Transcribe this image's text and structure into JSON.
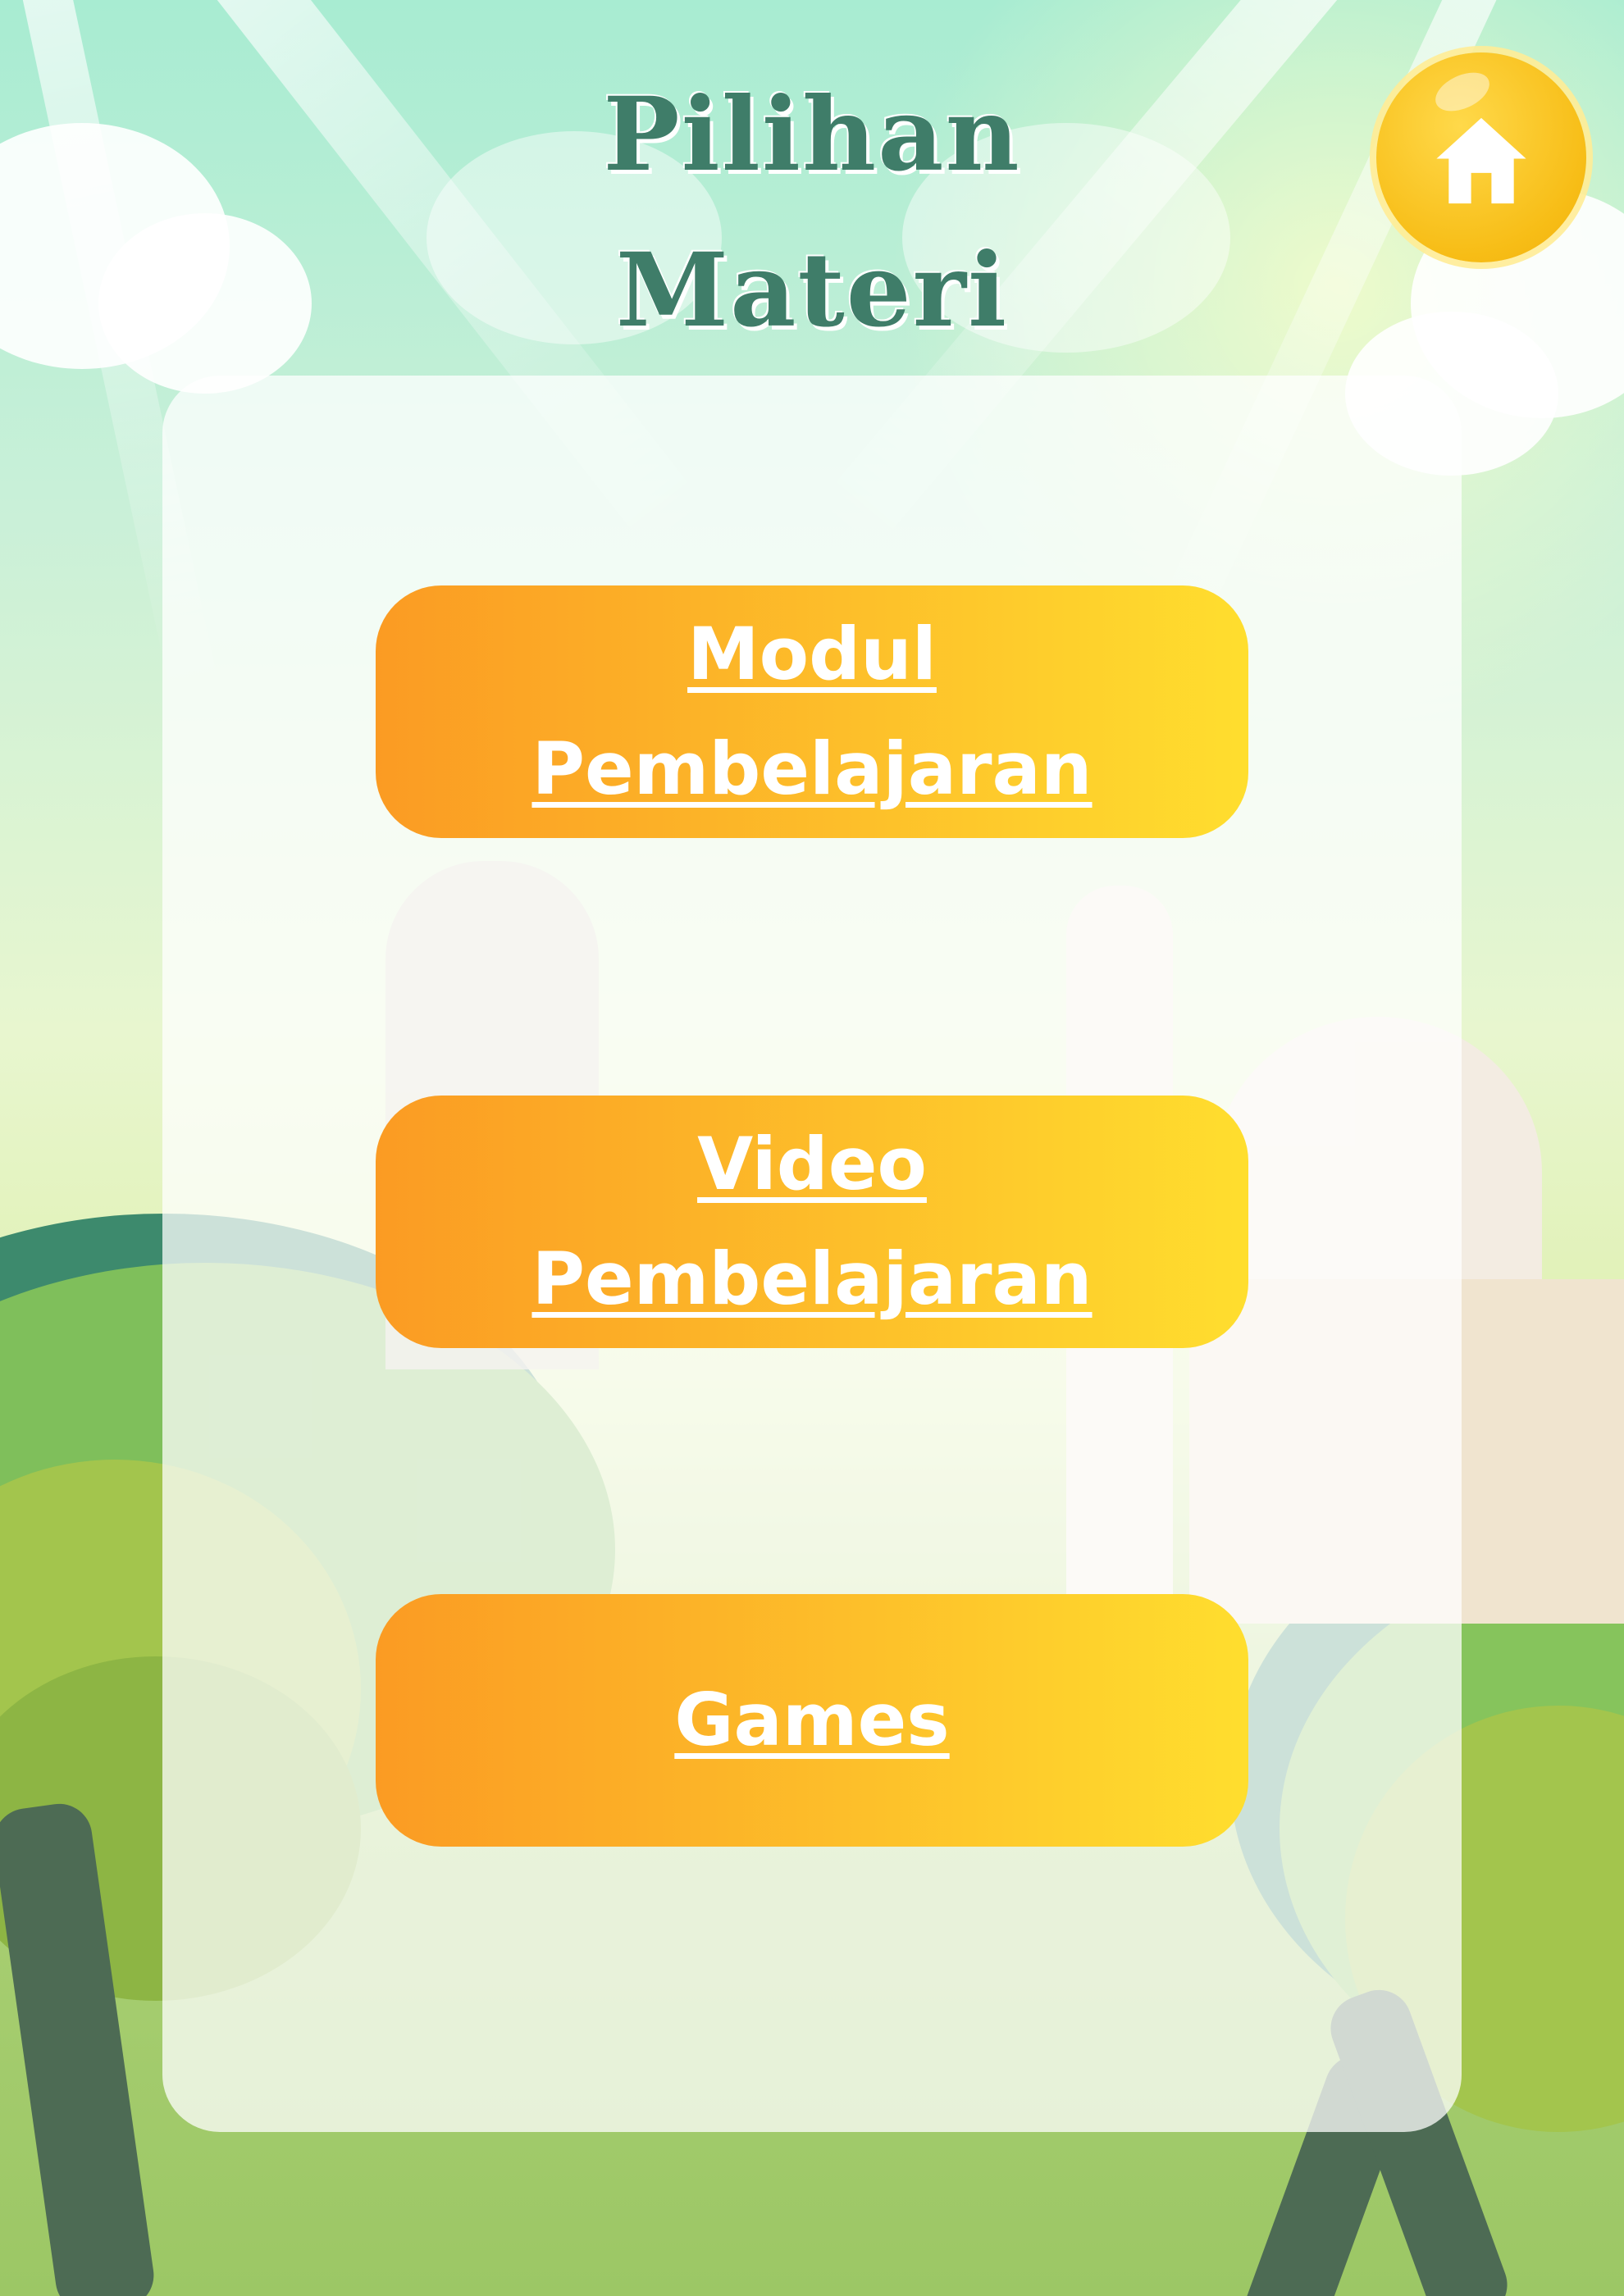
{
  "page": {
    "title_lines": [
      "Pilihan",
      "Materi"
    ]
  },
  "header": {
    "home_icon": "home-icon"
  },
  "menu": {
    "items": [
      {
        "label": "Modul\nPembelajaran"
      },
      {
        "label": "Video\nPembelajaran"
      },
      {
        "label": "Games"
      }
    ]
  },
  "colors": {
    "title": "#3f7d69",
    "button_gradient_start": "#fb9b23",
    "button_gradient_end": "#ffde2e",
    "home_button": "#f7bd16"
  }
}
